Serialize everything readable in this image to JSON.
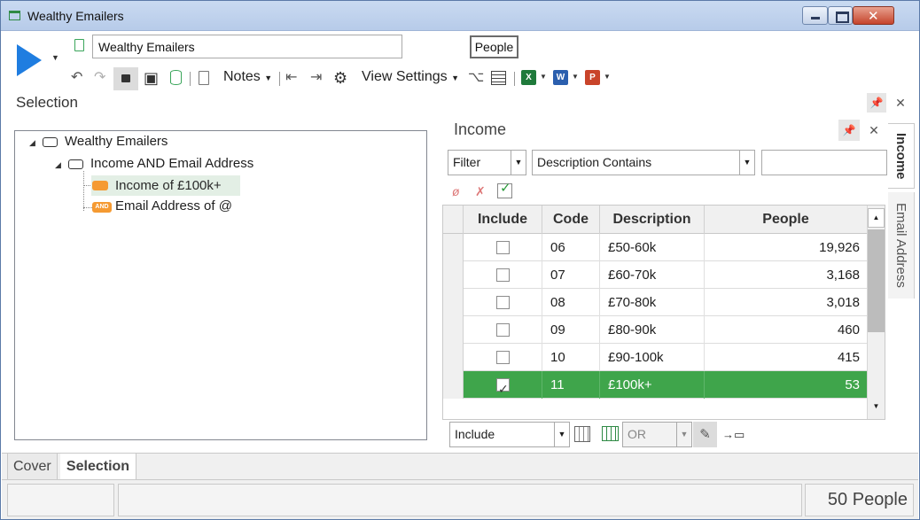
{
  "window": {
    "title": "Wealthy Emailers"
  },
  "ribbon": {
    "name_value": "Wealthy Emailers",
    "people_button": "People",
    "notes_label": "Notes",
    "view_settings_label": "View Settings",
    "excel_letter": "X",
    "word_letter": "W",
    "ppt_letter": "P"
  },
  "selection": {
    "header": "Selection",
    "tree": [
      {
        "label": "Wealthy Emailers",
        "type": "root"
      },
      {
        "label": "Income AND Email Address",
        "type": "and-group"
      },
      {
        "label": "Income of £100k+",
        "type": "selected-leaf"
      },
      {
        "label": "Email Address of @",
        "type": "leaf"
      }
    ],
    "and_badge": "AND"
  },
  "income": {
    "title": "Income",
    "filter_mode": "Filter",
    "filter_field": "Description Contains",
    "filter_text": "",
    "columns": [
      "Include",
      "Code",
      "Description",
      "People"
    ],
    "rows": [
      {
        "include": false,
        "code": "06",
        "description": "£50-60k",
        "people": "19,926"
      },
      {
        "include": false,
        "code": "07",
        "description": "£60-70k",
        "people": "3,168"
      },
      {
        "include": false,
        "code": "08",
        "description": "£70-80k",
        "people": "3,018"
      },
      {
        "include": false,
        "code": "09",
        "description": "£80-90k",
        "people": "460"
      },
      {
        "include": false,
        "code": "10",
        "description": "£90-100k",
        "people": "415"
      },
      {
        "include": true,
        "code": "11",
        "description": "£100k+",
        "people": "53"
      }
    ],
    "bottom_include": "Include",
    "bottom_or": "OR"
  },
  "side_tabs": [
    "Income",
    "Email Address"
  ],
  "bottom_tabs": [
    "Cover",
    "Selection"
  ],
  "status": {
    "count": "50 People"
  },
  "colors": {
    "selected_row": "#3fa54b",
    "accent_blue": "#1f7de0",
    "node_orange": "#f59a32"
  }
}
